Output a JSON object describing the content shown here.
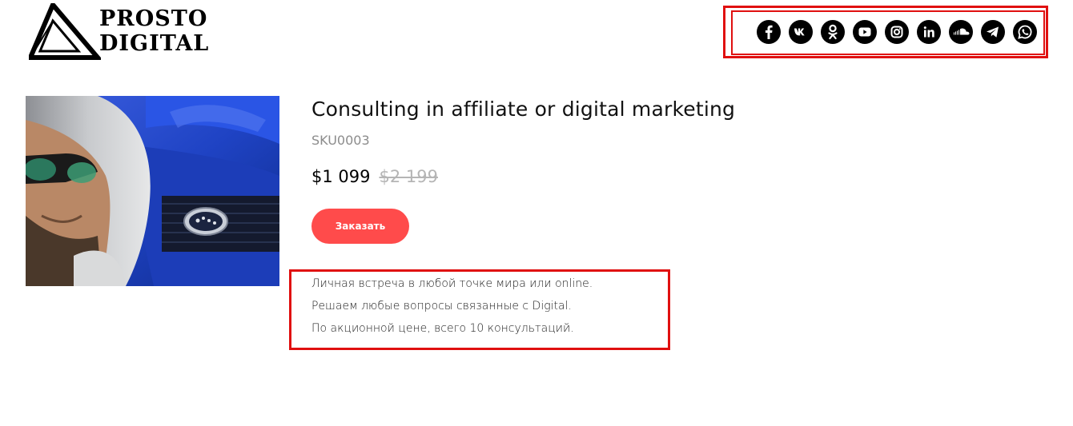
{
  "logo": {
    "line1": "PROSTO",
    "line2": "DIGITAL"
  },
  "social": [
    {
      "icon": "facebook-icon",
      "label": "f"
    },
    {
      "icon": "vk-icon",
      "label": "vk"
    },
    {
      "icon": "odnoklassniki-icon",
      "label": "ok"
    },
    {
      "icon": "youtube-icon",
      "label": "yt"
    },
    {
      "icon": "instagram-icon",
      "label": "ig"
    },
    {
      "icon": "linkedin-icon",
      "label": "in"
    },
    {
      "icon": "soundcloud-icon",
      "label": "sc"
    },
    {
      "icon": "telegram-icon",
      "label": "tg"
    },
    {
      "icon": "whatsapp-icon",
      "label": "wa"
    }
  ],
  "product": {
    "title": "Consulting in affiliate or digital marketing",
    "sku": "SKU0003",
    "price": "$1 099",
    "old_price": "$2 199",
    "order_label": "Заказать",
    "description": [
      "Личная встреча в любой точке мира или online.",
      "Решаем любые вопросы связанные с Digital.",
      "По акционной цене, всего 10 консультаций."
    ]
  },
  "colors": {
    "accent": "#ff4b4b",
    "highlight_frame": "#e01010",
    "old_price": "#b5b5b5",
    "car_blue": "#1f43c4"
  }
}
